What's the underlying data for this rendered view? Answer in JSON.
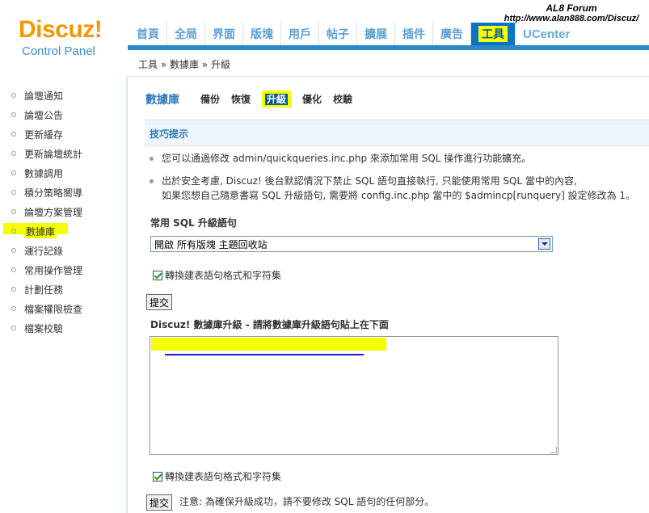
{
  "logo": {
    "brand": "Discuz!",
    "subtitle": "Control Panel"
  },
  "watermark": {
    "line1": "AL8 Forum",
    "line2": "http://www.alan888.com/Discuz/"
  },
  "nav": {
    "tabs": [
      "首頁",
      "全局",
      "界面",
      "版塊",
      "用戶",
      "帖子",
      "擴展",
      "插件",
      "廣告",
      "工具",
      "UCenter"
    ],
    "active": "工具"
  },
  "breadcrumb": "工具 » 數據庫 » 升級",
  "sidebar": {
    "items": [
      "論壇通知",
      "論壇公告",
      "更新緩存",
      "更新論壇統計",
      "數據調用",
      "積分策略嚮導",
      "論壇方案管理",
      "數據庫",
      "運行記錄",
      "常用操作管理",
      "計劃任務",
      "檔案權限檢查",
      "檔案校驗"
    ],
    "active": "數據庫"
  },
  "subnav": {
    "title": "數據庫",
    "tabs": [
      "備份",
      "恢復",
      "升級",
      "優化",
      "校驗"
    ],
    "active": "升級"
  },
  "tips": {
    "heading": "技巧提示",
    "tip1": "您可以通過修改 admin/quickqueries.inc.php 來添加常用 SQL 操作進行功能擴充。",
    "tip2_line1": "出於安全考慮, Discuz! 後台默認情況下禁止 SQL 語句直接執行, 只能使用常用 SQL 當中的內容,",
    "tip2_line2": "如果您想自己隨意書寫 SQL 升級語句, 需要將 config.inc.php 當中的 $admincp[runquery] 設定修改為 1。"
  },
  "common_sql": {
    "label": "常用 SQL 升級語句",
    "selected": "開啟 所有版塊 主題回收站"
  },
  "convert_checkbox_label": "轉換建表語句格式和字符集",
  "submit_label": "提交",
  "upgrade_section": {
    "label": "Discuz! 數據庫升級 - 請將數據庫升級語句貼上在下面"
  },
  "note": "注意: 為確保升級成功，請不要修改 SQL 語句的任何部分。",
  "colors": {
    "accent": "#2a88c8",
    "highlight": "#f5ff00",
    "brand": "#f39800"
  }
}
